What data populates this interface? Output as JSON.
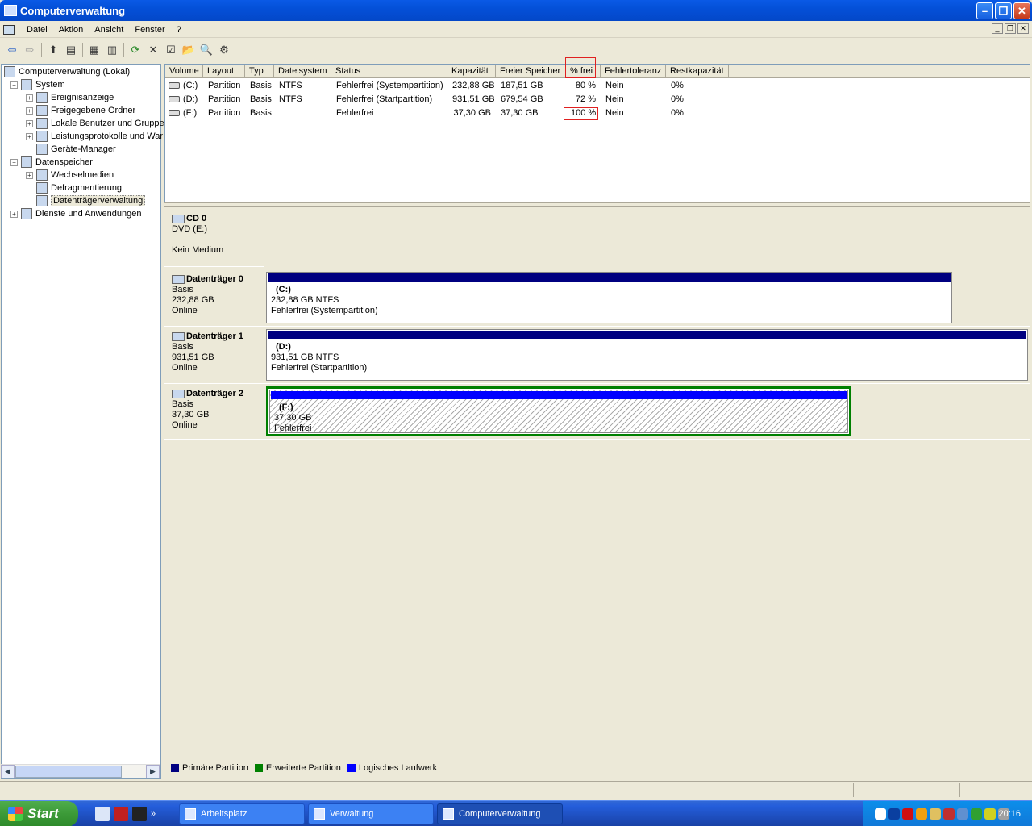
{
  "window": {
    "title": "Computerverwaltung"
  },
  "menu": [
    "Datei",
    "Aktion",
    "Ansicht",
    "Fenster",
    "?"
  ],
  "tree": [
    {
      "label": "Computerverwaltung (Lokal)",
      "level": 0,
      "toggle": ""
    },
    {
      "label": "System",
      "level": 1,
      "toggle": "−"
    },
    {
      "label": "Ereignisanzeige",
      "level": 2,
      "toggle": "+"
    },
    {
      "label": "Freigegebene Ordner",
      "level": 2,
      "toggle": "+"
    },
    {
      "label": "Lokale Benutzer und Gruppe",
      "level": 2,
      "toggle": "+"
    },
    {
      "label": "Leistungsprotokolle und War",
      "level": 2,
      "toggle": "+"
    },
    {
      "label": "Geräte-Manager",
      "level": 2,
      "toggle": ""
    },
    {
      "label": "Datenspeicher",
      "level": 1,
      "toggle": "−"
    },
    {
      "label": "Wechselmedien",
      "level": 2,
      "toggle": "+"
    },
    {
      "label": "Defragmentierung",
      "level": 2,
      "toggle": ""
    },
    {
      "label": "Datenträgerverwaltung",
      "level": 2,
      "toggle": "",
      "selected": true
    },
    {
      "label": "Dienste und Anwendungen",
      "level": 1,
      "toggle": "+"
    }
  ],
  "volumes": {
    "columns": [
      "Volume",
      "Layout",
      "Typ",
      "Dateisystem",
      "Status",
      "Kapazität",
      "Freier Speicher",
      "% frei",
      "Fehlertoleranz",
      "Restkapazität"
    ],
    "rows": [
      [
        "(C:)",
        "Partition",
        "Basis",
        "NTFS",
        "Fehlerfrei (Systempartition)",
        "232,88 GB",
        "187,51 GB",
        "80 %",
        "Nein",
        "0%"
      ],
      [
        "(D:)",
        "Partition",
        "Basis",
        "NTFS",
        "Fehlerfrei (Startpartition)",
        "931,51 GB",
        "679,54 GB",
        "72 %",
        "Nein",
        "0%"
      ],
      [
        "(F:)",
        "Partition",
        "Basis",
        "",
        "Fehlerfrei",
        "37,30 GB",
        "37,30 GB",
        "100 %",
        "Nein",
        "0%"
      ]
    ]
  },
  "disks": [
    {
      "name": "CD 0",
      "line1": "DVD (E:)",
      "line2": "",
      "line3": "Kein Medium",
      "partition": null
    },
    {
      "name": "Datenträger 0",
      "line1": "Basis",
      "line2": "232,88 GB",
      "line3": "Online",
      "partition": {
        "label": "(C:)",
        "size": "232,88 GB NTFS",
        "status": "Fehlerfrei (Systempartition)",
        "bar_color": "#000080"
      }
    },
    {
      "name": "Datenträger 1",
      "line1": "Basis",
      "line2": "931,51 GB",
      "line3": "Online",
      "partition": {
        "label": "(D:)",
        "size": "931,51 GB NTFS",
        "status": "Fehlerfrei (Startpartition)",
        "bar_color": "#000080"
      }
    },
    {
      "name": "Datenträger 2",
      "line1": "Basis",
      "line2": "37,30 GB",
      "line3": "Online",
      "partition": {
        "label": "(F:)",
        "size": "37,30 GB",
        "status": "Fehlerfrei",
        "bar_color": "#0000ff",
        "extended_color": "#008000"
      }
    }
  ],
  "legend": [
    {
      "label": "Primäre Partition",
      "color": "#000080"
    },
    {
      "label": "Erweiterte Partition",
      "color": "#008000"
    },
    {
      "label": "Logisches Laufwerk",
      "color": "#0000ff"
    }
  ],
  "taskbar": {
    "start_label": "Start",
    "tasks": [
      {
        "label": "Arbeitsplatz",
        "active": false
      },
      {
        "label": "Verwaltung",
        "active": false
      },
      {
        "label": "Computerverwaltung",
        "active": true
      }
    ],
    "clock": "20:16"
  }
}
